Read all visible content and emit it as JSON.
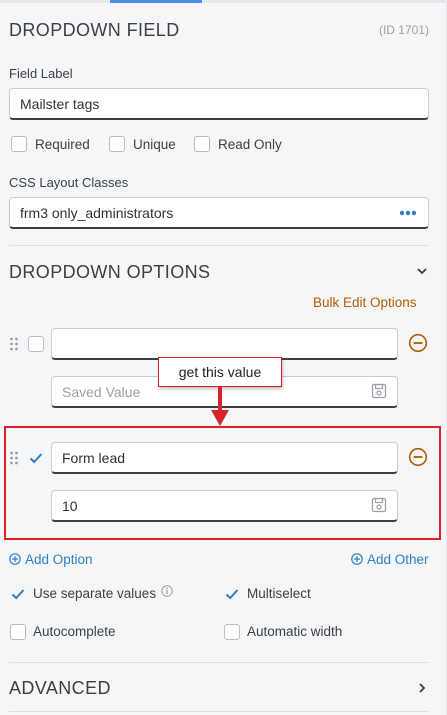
{
  "field": {
    "title": "DROPDOWN FIELD",
    "id_text": "(ID 1701)",
    "label_caption": "Field Label",
    "label_value": "Mailster tags",
    "required_label": "Required",
    "unique_label": "Unique",
    "readonly_label": "Read Only",
    "css_caption": "CSS Layout Classes",
    "css_value": "frm3 only_administrators"
  },
  "options": {
    "title": "DROPDOWN OPTIONS",
    "bulk_edit_label": "Bulk Edit Options",
    "rows": [
      {
        "label": "",
        "saved_placeholder": "Saved Value",
        "saved_value": "",
        "checked": false
      },
      {
        "label": "Form lead",
        "saved_placeholder": "",
        "saved_value": "10",
        "checked": true
      }
    ],
    "add_option_label": "Add Option",
    "add_other_label": "Add Other",
    "use_separate_values_label": "Use separate values",
    "multiselect_label": "Multiselect",
    "autocomplete_label": "Autocomplete",
    "automatic_width_label": "Automatic width",
    "use_separate_values_checked": true,
    "multiselect_checked": true,
    "autocomplete_checked": false,
    "automatic_width_checked": false
  },
  "advanced": {
    "title": "ADVANCED"
  },
  "annotation": {
    "callout_text": "get this value"
  },
  "colors": {
    "accent": "#2d7fc8",
    "link_orange": "#b35c00",
    "annotation_red": "#d8232a"
  },
  "icons": [
    "ellipsis-icon",
    "chevron-down-icon",
    "drag-handle-icon",
    "remove-circle-icon",
    "save-icon",
    "plus-circle-icon",
    "info-icon",
    "chevron-right-icon",
    "check-icon"
  ]
}
